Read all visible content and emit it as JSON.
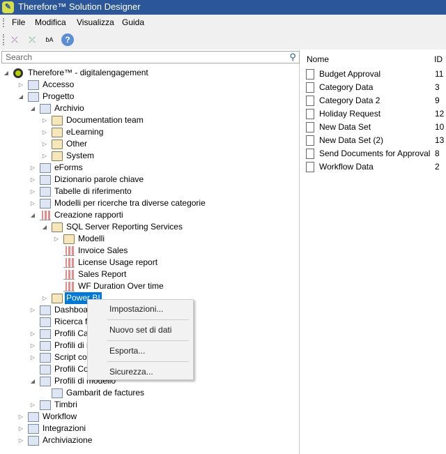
{
  "window": {
    "title": "Therefore™ Solution Designer"
  },
  "menu": [
    "File",
    "Modifica",
    "Visualizza",
    "Guida"
  ],
  "toolbar": [
    "deploy-icon",
    "import-icon",
    "translate-icon",
    "help-icon"
  ],
  "search": {
    "placeholder": "Search"
  },
  "tree": [
    {
      "l": 0,
      "e": "open",
      "i": "server",
      "t": "Therefore™ - digitalengagement"
    },
    {
      "l": 1,
      "e": "closed",
      "i": "gen",
      "t": "Accesso"
    },
    {
      "l": 1,
      "e": "open",
      "i": "gen",
      "t": "Progetto"
    },
    {
      "l": 2,
      "e": "open",
      "i": "gen",
      "t": "Archivio"
    },
    {
      "l": 3,
      "e": "closed",
      "i": "folder",
      "t": "Documentation team"
    },
    {
      "l": 3,
      "e": "closed",
      "i": "folder",
      "t": "eLearning"
    },
    {
      "l": 3,
      "e": "closed",
      "i": "folder",
      "t": "Other"
    },
    {
      "l": 3,
      "e": "closed",
      "i": "folder",
      "t": "System"
    },
    {
      "l": 2,
      "e": "closed",
      "i": "gen",
      "t": "eForms"
    },
    {
      "l": 2,
      "e": "closed",
      "i": "gen",
      "t": "Dizionario parole chiave"
    },
    {
      "l": 2,
      "e": "closed",
      "i": "gen",
      "t": "Tabelle di riferimento"
    },
    {
      "l": 2,
      "e": "closed",
      "i": "gen",
      "t": "Modelli per ricerche tra diverse categorie"
    },
    {
      "l": 2,
      "e": "open",
      "i": "report",
      "t": "Creazione rapporti"
    },
    {
      "l": 3,
      "e": "open",
      "i": "folder",
      "t": "SQL Server Reporting Services"
    },
    {
      "l": 4,
      "e": "closed",
      "i": "folder",
      "t": "Modelli"
    },
    {
      "l": 4,
      "e": "none",
      "i": "report",
      "t": "Invoice Sales"
    },
    {
      "l": 4,
      "e": "none",
      "i": "report",
      "t": "License Usage report"
    },
    {
      "l": 4,
      "e": "none",
      "i": "report",
      "t": "Sales Report"
    },
    {
      "l": 4,
      "e": "none",
      "i": "report",
      "t": "WF Duration Over time"
    },
    {
      "l": 3,
      "e": "closed",
      "i": "folder",
      "t": "Power BI",
      "sel": true
    },
    {
      "l": 2,
      "e": "closed",
      "i": "gen",
      "t": "Dashboard"
    },
    {
      "l": 2,
      "e": "none",
      "i": "gen",
      "t": "Ricerca ful"
    },
    {
      "l": 2,
      "e": "closed",
      "i": "gen",
      "t": "Profili Capt"
    },
    {
      "l": 2,
      "e": "closed",
      "i": "gen",
      "t": "Profili di ind"
    },
    {
      "l": 2,
      "e": "closed",
      "i": "gen",
      "t": "Script com"
    },
    {
      "l": 2,
      "e": "none",
      "i": "gen",
      "t": "Profili Conn"
    },
    {
      "l": 2,
      "e": "open",
      "i": "gen",
      "t": "Profili di modello"
    },
    {
      "l": 3,
      "e": "none",
      "i": "gen",
      "t": "Gambarit de factures"
    },
    {
      "l": 2,
      "e": "closed",
      "i": "gen",
      "t": "Timbri"
    },
    {
      "l": 1,
      "e": "closed",
      "i": "gen",
      "t": "Workflow"
    },
    {
      "l": 1,
      "e": "closed",
      "i": "gen",
      "t": "Integrazioni"
    },
    {
      "l": 1,
      "e": "closed",
      "i": "gen",
      "t": "Archiviazione"
    }
  ],
  "list": {
    "headers": {
      "name": "Nome",
      "id": "ID"
    },
    "rows": [
      {
        "name": "Budget Approval",
        "id": "11"
      },
      {
        "name": "Category Data",
        "id": "3"
      },
      {
        "name": "Category Data 2",
        "id": "9"
      },
      {
        "name": "Holiday Request",
        "id": "12"
      },
      {
        "name": "New Data Set",
        "id": "10"
      },
      {
        "name": "New Data Set (2)",
        "id": "13"
      },
      {
        "name": "Send Documents for Approval",
        "id": "8"
      },
      {
        "name": "Workflow Data",
        "id": "2"
      }
    ]
  },
  "context_menu": [
    "Impostazioni...",
    "Nuovo set di dati",
    "Esporta...",
    "Sicurezza..."
  ]
}
